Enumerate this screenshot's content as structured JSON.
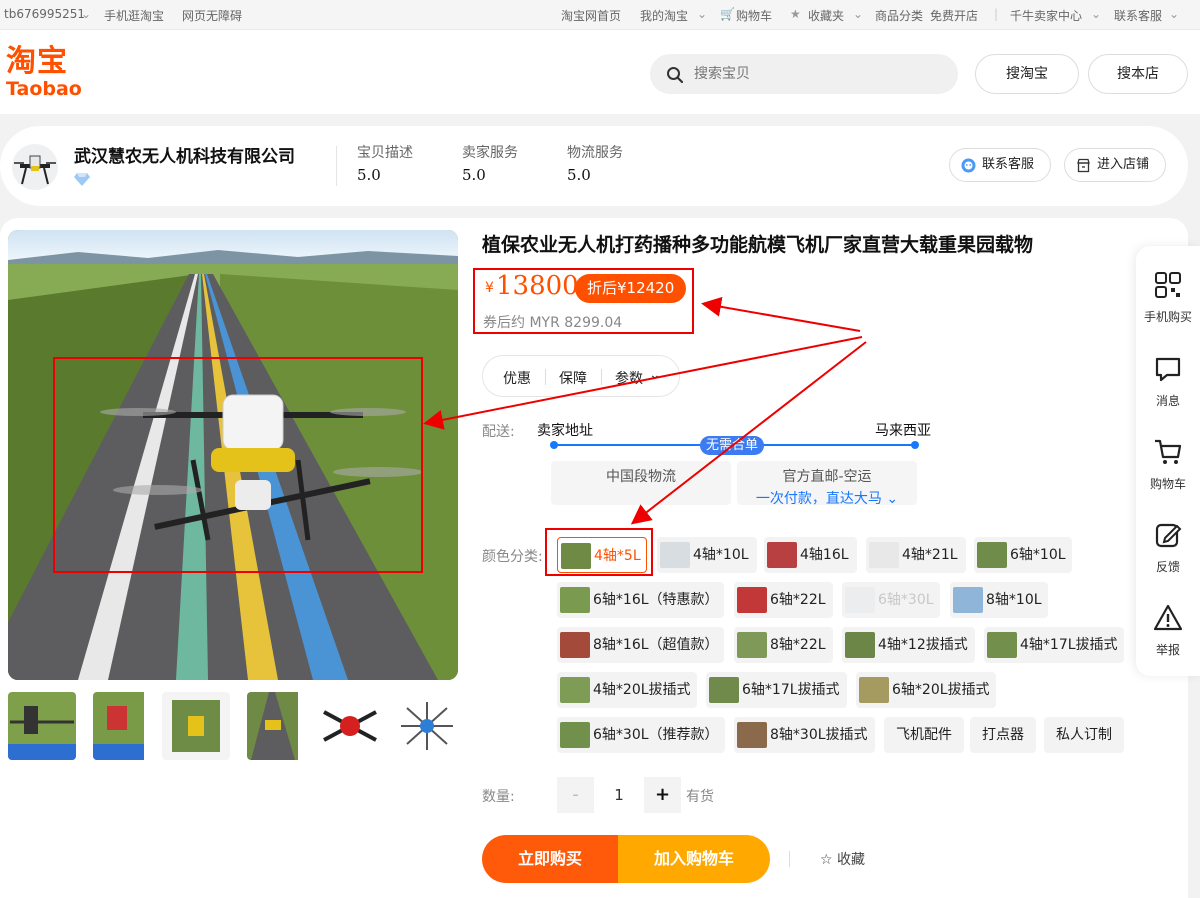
{
  "topbar": {
    "user": "tb676995251",
    "mobile": "手机逛淘宝",
    "accessible": "网页无障碍",
    "home": "淘宝网首页",
    "my_taobao": "我的淘宝",
    "cart": "购物车",
    "favorites": "收藏夹",
    "categories": "商品分类",
    "open_shop": "免费开店",
    "seller_center": "千牛卖家中心",
    "contact": "联系客服"
  },
  "header": {
    "logo_cn": "淘宝",
    "logo_en": "Taobao",
    "search_placeholder": "搜索宝贝",
    "search_taobao": "搜淘宝",
    "search_shop": "搜本店"
  },
  "shop": {
    "name": "武汉慧农无人机科技有限公司",
    "scores": [
      {
        "label": "宝贝描述",
        "value": "5.0"
      },
      {
        "label": "卖家服务",
        "value": "5.0"
      },
      {
        "label": "物流服务",
        "value": "5.0"
      }
    ],
    "contact_btn": "联系客服",
    "enter_btn": "进入店铺"
  },
  "product": {
    "title": "植保农业无人机打药播种多功能航模飞机厂家直营大载重果园载物",
    "currency": "¥",
    "price": "13800",
    "discount": "折后¥12420",
    "coupon": "券后约 MYR 8299.04",
    "tabs": [
      "优惠",
      "保障",
      "参数"
    ],
    "shipping_label": "配送:",
    "from": "卖家地址",
    "to": "马来西亚",
    "route_tag": "无需合单",
    "ship_options": [
      {
        "line1": "中国段物流",
        "line2": ""
      },
      {
        "line1": "官方直邮-空运",
        "line2": "一次付款，直达大马"
      }
    ],
    "color_label": "颜色分类:",
    "variants": [
      "4轴*5L",
      "4轴*10L",
      "4轴16L",
      "4轴*21L",
      "6轴*10L",
      "6轴*16L（特惠款）",
      "6轴*22L",
      "6轴*30L",
      "8轴*10L",
      "8轴*16L（超值款）",
      "8轴*22L",
      "4轴*12拔插式",
      "4轴*17L拔插式",
      "4轴*20L拔插式",
      "6轴*17L拔插式",
      "6轴*20L拔插式",
      "6轴*30L（推荐款）",
      "8轴*30L拔插式",
      "飞机配件",
      "打点器",
      "私人订制"
    ],
    "selected_variant": "4轴*5L",
    "disabled_variant": "6轴*30L",
    "qty_label": "数量:",
    "qty_minus": "-",
    "qty_value": "1",
    "qty_plus": "+",
    "stock": "有货",
    "buy_now": "立即购买",
    "add_cart": "加入购物车",
    "favorite": "收藏"
  },
  "sidebar": [
    "手机购买",
    "消息",
    "购物车",
    "反馈",
    "举报"
  ],
  "colors": {
    "brand": "#ff5000",
    "accent_blue": "#1677ff",
    "annotation_red": "#e00000"
  }
}
